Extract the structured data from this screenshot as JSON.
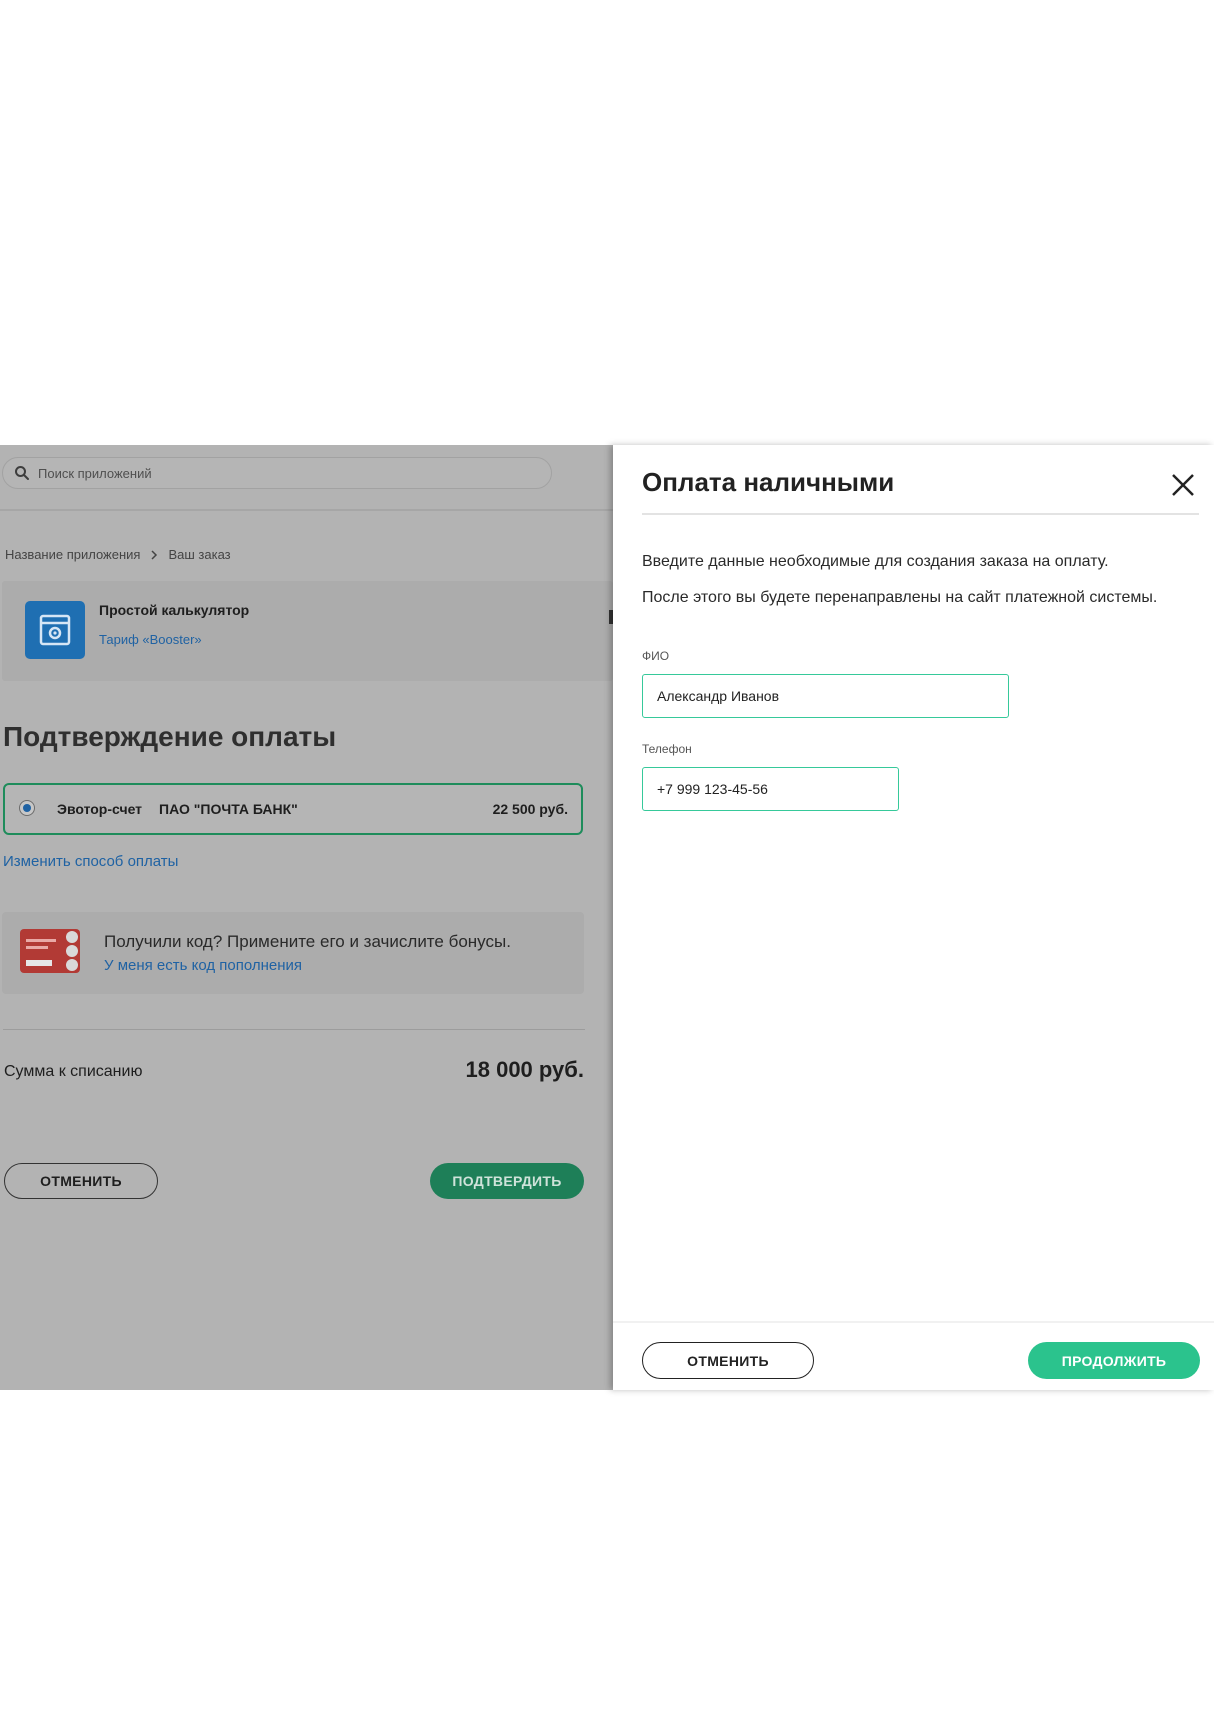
{
  "background_page": {
    "search": {
      "placeholder": "Поиск приложений"
    },
    "breadcrumb": [
      "Название приложения",
      "Ваш заказ"
    ],
    "app": {
      "name": "Простой калькулятор",
      "tariff": "Тариф «Booster»"
    },
    "title": "Подтверждение оплаты",
    "payment_method": {
      "name": "Эвотор-счет",
      "bank": "ПАО \"ПОЧТА БАНК\"",
      "price": "22 500 руб.",
      "selected": true
    },
    "change_payment_link": "Изменить способ оплаты",
    "bonus": {
      "text": "Получили код? Примените его и зачислите бонусы.",
      "link": "У меня есть код пополнения"
    },
    "sum": {
      "label": "Сумма к списанию",
      "value": "18 000 руб."
    },
    "buttons": {
      "cancel": "ОТМЕНИТЬ",
      "confirm": "ПОДТВЕРДИТЬ"
    }
  },
  "modal": {
    "title": "Оплата наличными",
    "description_1": "Введите данные необходимые для создания заказа на оплату.",
    "description_2": "После этого вы будете перенаправлены на сайт платежной системы.",
    "fields": {
      "fio": {
        "label": "ФИО",
        "value": "Александр Иванов"
      },
      "phone": {
        "label": "Телефон",
        "value": "+7 999 123-45-56"
      }
    },
    "buttons": {
      "cancel": "ОТМЕНИТЬ",
      "continue": "ПРОДОЛЖИТЬ"
    }
  },
  "colors": {
    "accent_green": "#2bc38d",
    "input_border": "#36c99a",
    "link_blue": "#1f62a3",
    "overlay_gray": "#b3b3b3",
    "app_icon_blue": "#1f6fb2",
    "bonus_card_red": "#c0392b"
  },
  "icons": {
    "search": "search-icon",
    "close": "close-icon",
    "app": "calculator-app-icon",
    "bonus": "gift-card-icon",
    "breadcrumb_separator": "chevron-right-icon"
  }
}
